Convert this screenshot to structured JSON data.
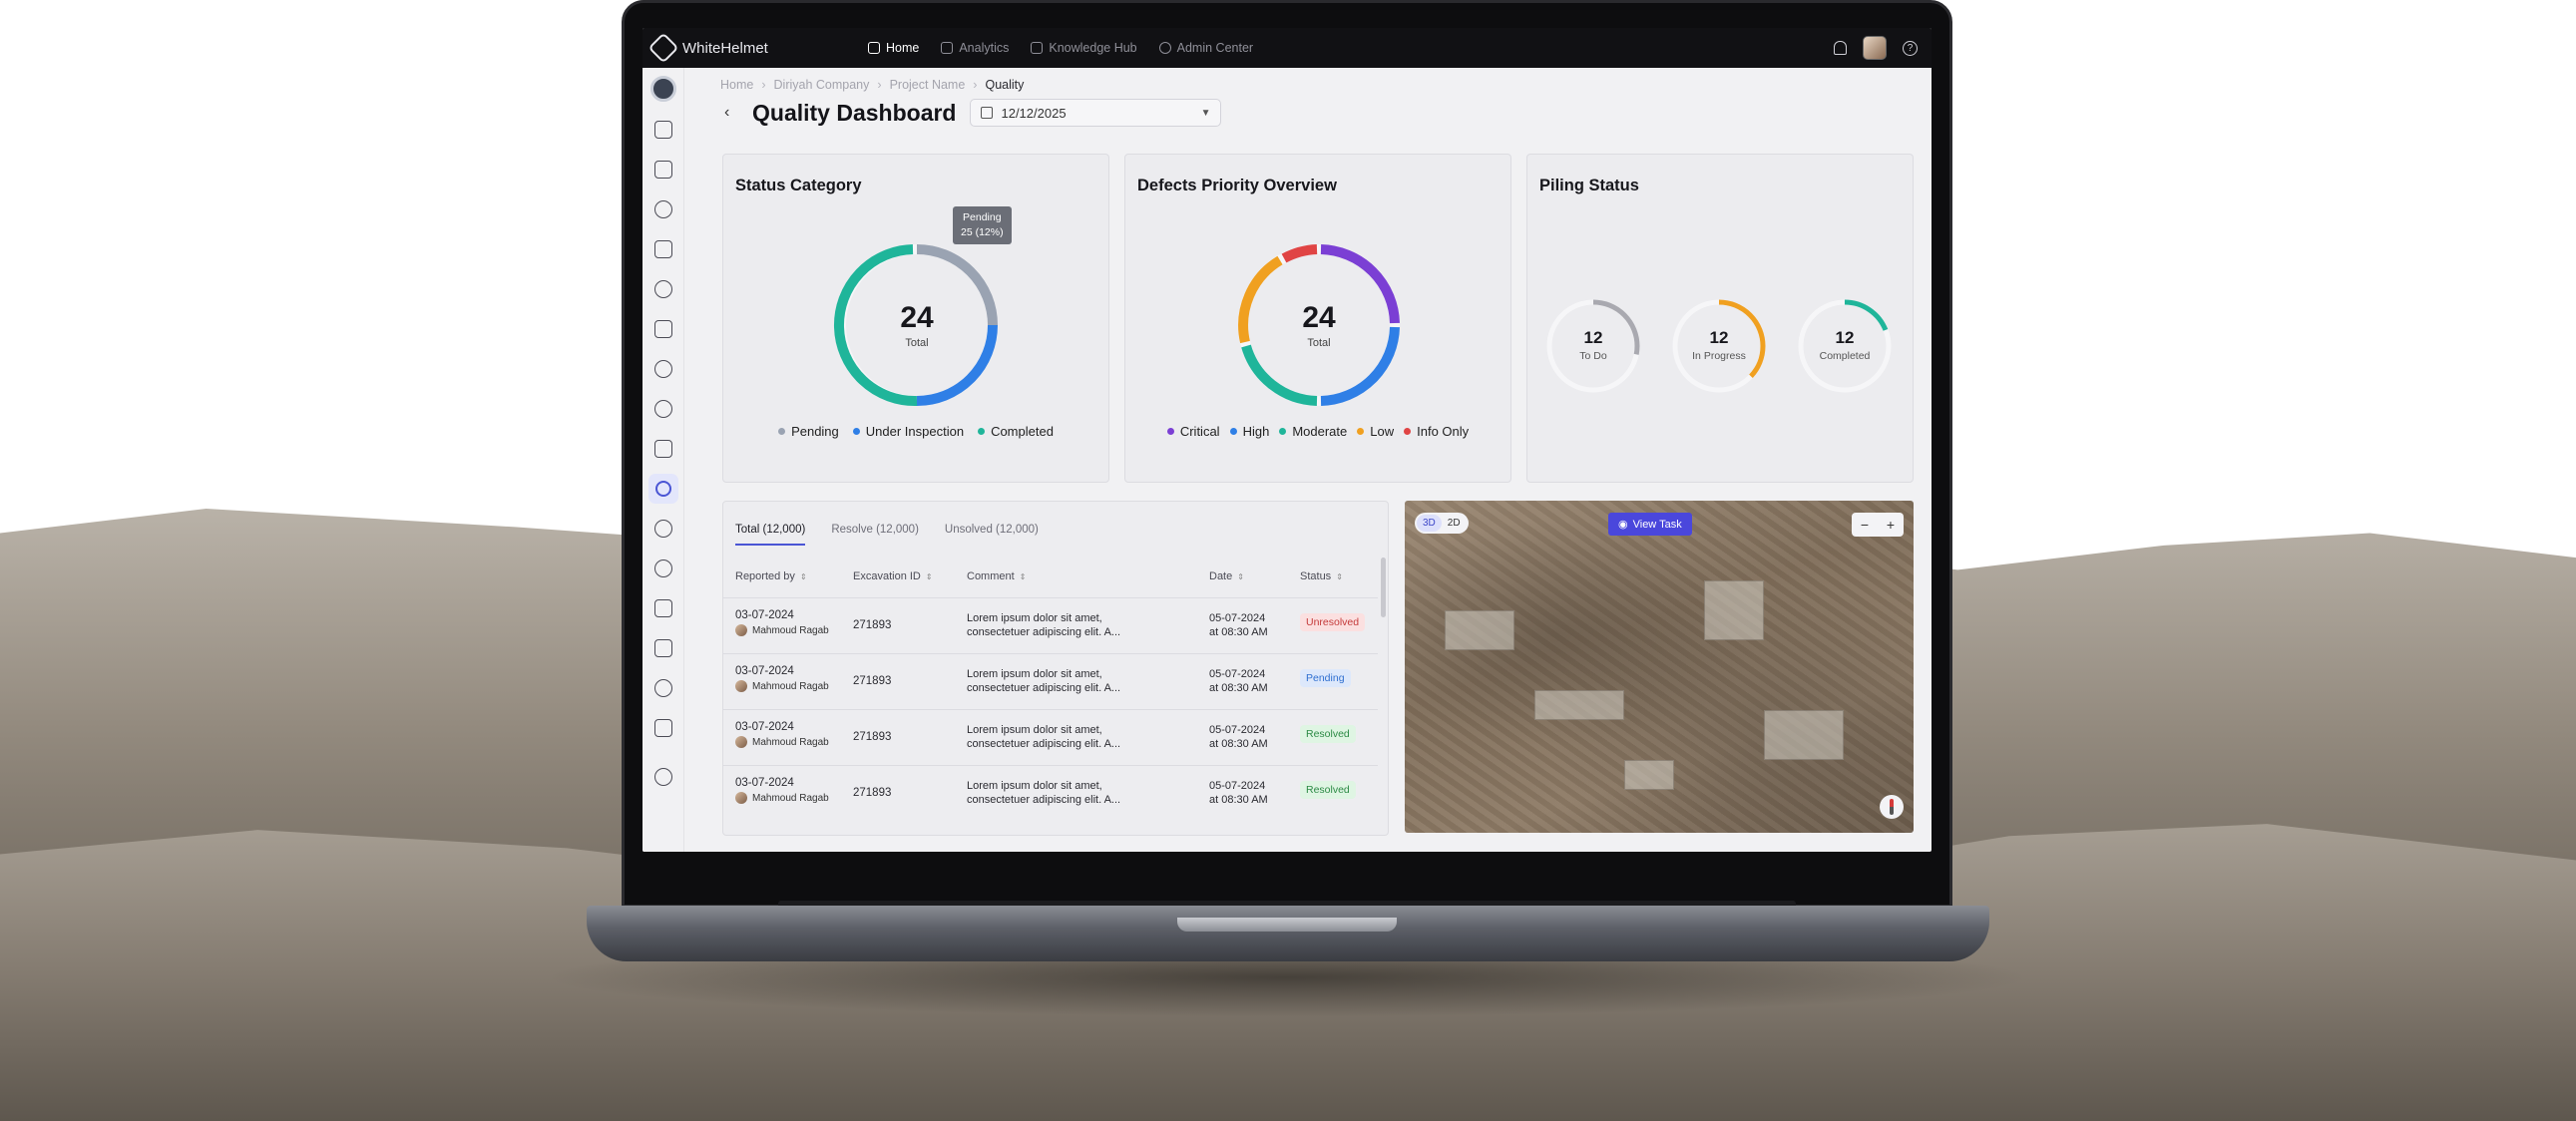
{
  "app": {
    "brand": "WhiteHelmet",
    "nav": [
      {
        "label": "Home",
        "icon": "home-icon"
      },
      {
        "label": "Analytics",
        "icon": "analytics-icon"
      },
      {
        "label": "Knowledge Hub",
        "icon": "book-icon"
      },
      {
        "label": "Admin Center",
        "icon": "gear-icon"
      }
    ]
  },
  "breadcrumb": [
    "Home",
    "Diriyah Company",
    "Project Name",
    "Quality"
  ],
  "page": {
    "title": "Quality Dashboard",
    "date": "12/12/2025"
  },
  "colors": {
    "pending": "#9aa3b2",
    "under_inspection": "#2f7fe6",
    "completed": "#1fb59a",
    "critical": "#7b3fd4",
    "high": "#2f7fe6",
    "moderate": "#1fb59a",
    "low": "#f0a020",
    "info_only": "#e04444",
    "accent": "#4a47dc"
  },
  "status_category": {
    "title": "Status Category",
    "total": "24",
    "total_label": "Total",
    "tooltip_line1": "Pending",
    "tooltip_line2": "25 (12%)",
    "legend": [
      "Pending",
      "Under Inspection",
      "Completed"
    ]
  },
  "defects_priority": {
    "title": "Defects Priority Overview",
    "total": "24",
    "total_label": "Total",
    "legend": [
      "Critical",
      "High",
      "Moderate",
      "Low",
      "Info Only"
    ]
  },
  "piling_status": {
    "title": "Piling Status",
    "items": [
      {
        "value": "12",
        "label": "To Do",
        "color": "#a9a9b0",
        "fraction": 0.28
      },
      {
        "value": "12",
        "label": "In Progress",
        "color": "#f0a020",
        "fraction": 0.37
      },
      {
        "value": "12",
        "label": "Completed",
        "color": "#1fb59a",
        "fraction": 0.19
      }
    ]
  },
  "table": {
    "tabs": [
      "Total (12,000)",
      "Resolve (12,000)",
      "Unsolved (12,000)"
    ],
    "columns": [
      "Reported by",
      "Excavation ID",
      "Comment",
      "Date",
      "Status"
    ],
    "rows": [
      {
        "reported_date": "03-07-2024",
        "reporter": "Mahmoud Ragab",
        "excavation_id": "271893",
        "comment1": "Lorem ipsum dolor sit amet,",
        "comment2": "consectetuer adipiscing elit. A...",
        "date1": "05-07-2024",
        "date2": "at 08:30 AM",
        "status": "Unresolved",
        "status_bg": "#fbe0e0",
        "status_fg": "#c43a3a"
      },
      {
        "reported_date": "03-07-2024",
        "reporter": "Mahmoud Ragab",
        "excavation_id": "271893",
        "comment1": "Lorem ipsum dolor sit amet,",
        "comment2": "consectetuer adipiscing elit. A...",
        "date1": "05-07-2024",
        "date2": "at 08:30 AM",
        "status": "Pending",
        "status_bg": "#dde8fb",
        "status_fg": "#2f6fd0"
      },
      {
        "reported_date": "03-07-2024",
        "reporter": "Mahmoud Ragab",
        "excavation_id": "271893",
        "comment1": "Lorem ipsum dolor sit amet,",
        "comment2": "consectetuer adipiscing elit. A...",
        "date1": "05-07-2024",
        "date2": "at 08:30 AM",
        "status": "Resolved",
        "status_bg": "#dff5e3",
        "status_fg": "#2c8a45"
      },
      {
        "reported_date": "03-07-2024",
        "reporter": "Mahmoud Ragab",
        "excavation_id": "271893",
        "comment1": "Lorem ipsum dolor sit amet,",
        "comment2": "consectetuer adipiscing elit. A...",
        "date1": "05-07-2024",
        "date2": "at 08:30 AM",
        "status": "Resolved",
        "status_bg": "#dff5e3",
        "status_fg": "#2c8a45"
      }
    ]
  },
  "map": {
    "mode_3d": "3D",
    "mode_2d": "2D",
    "view_task": "View Task",
    "zoom_out": "−",
    "zoom_in": "+"
  }
}
